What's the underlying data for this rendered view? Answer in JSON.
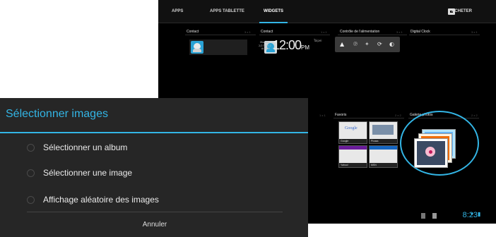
{
  "tablet": {
    "tabs": [
      "APPS",
      "APPS TABLETTE",
      "WIDGETS"
    ],
    "active_tab": "WIDGETS",
    "store_label": "ACHETER",
    "widgets": [
      {
        "label": "Contact",
        "size": "3 x 1"
      },
      {
        "label": "Contact",
        "size": "1 x 1"
      },
      {
        "label": "Contrôle de l'alimentation",
        "size": "3 x 1"
      },
      {
        "label": "Digital Clock",
        "size": "3 x 1"
      },
      {
        "label": "",
        "size": "1 x 1"
      },
      {
        "label": "Favoris",
        "size": "2 x 2"
      },
      {
        "label": "Galerie photos",
        "size": "2 x 2"
      }
    ],
    "clock": {
      "time": "12:00",
      "ampm": "PM",
      "city": "Taipei",
      "date": "Monday 2/27/2012 ALARM"
    },
    "favorites": [
      "Google",
      "Picasa",
      "Yahoo!",
      "MSN"
    ],
    "status_time": "8:23"
  },
  "dialog": {
    "title": "Sélectionner images",
    "options": [
      "Sélectionner un album",
      "Sélectionner une image",
      "Affichage aléatoire des images"
    ],
    "cancel_label": "Annuler"
  },
  "colors": {
    "accent": "#33b5e5",
    "dialog_bg": "#262626"
  }
}
